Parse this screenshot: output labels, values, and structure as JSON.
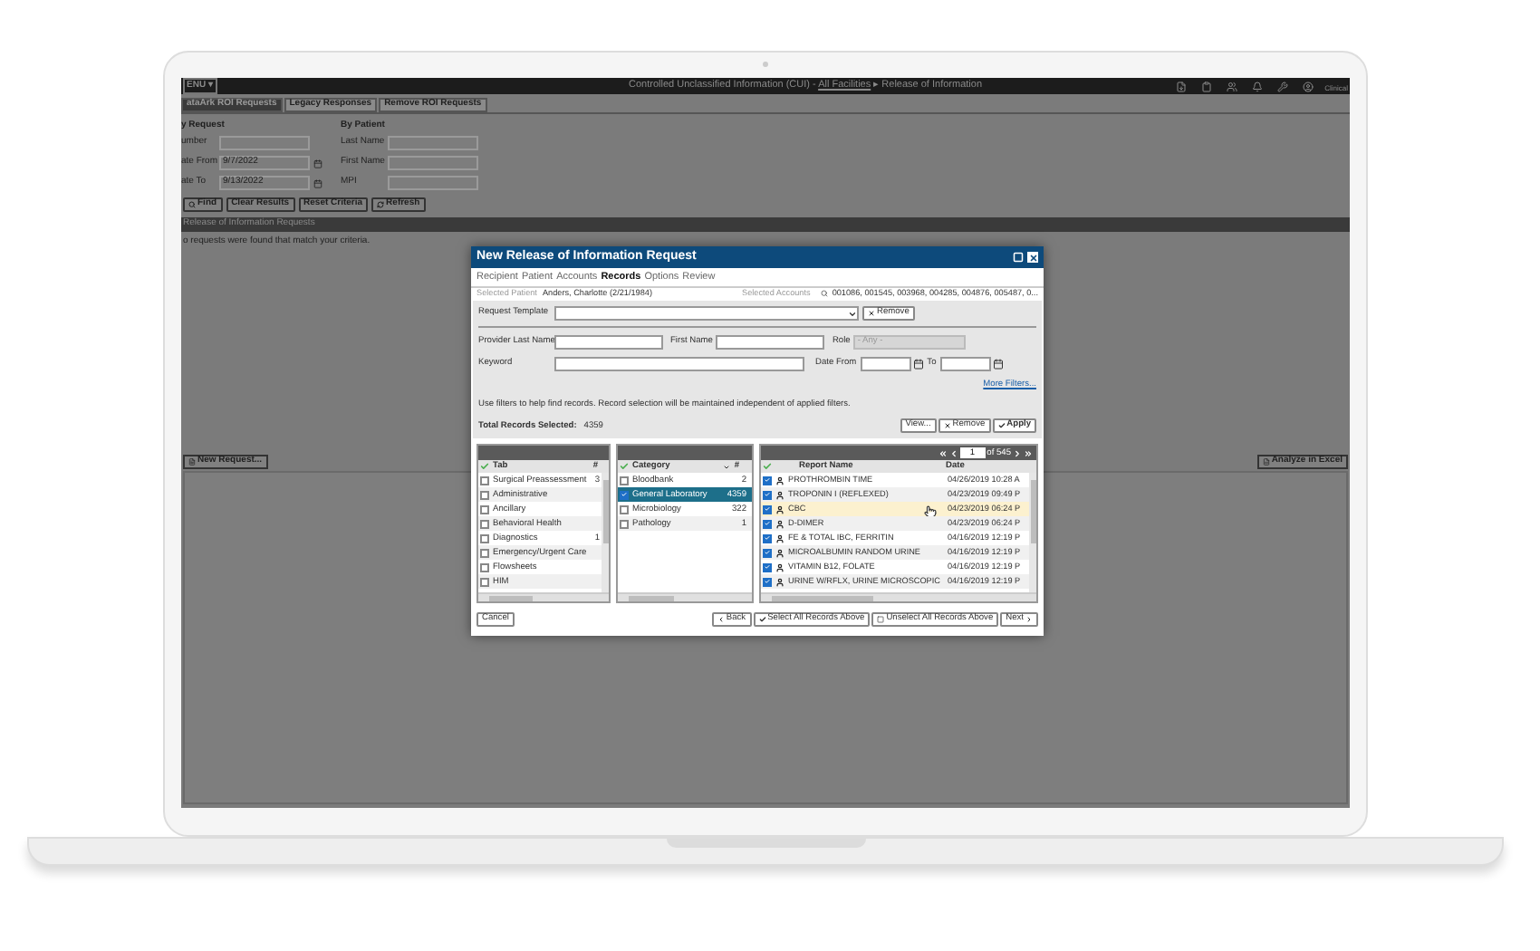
{
  "top_bar": {
    "menu": "ENU ▾",
    "title": "Controlled Unclassified Information (CUI) - ",
    "facility_link": "All Facilities",
    "location": " ▸ Release of Information",
    "user": "Clinical"
  },
  "tabs": [
    {
      "label": "ataArk ROI Requests",
      "selected": true
    },
    {
      "label": "Legacy Responses",
      "selected": false
    },
    {
      "label": "Remove ROI Requests",
      "selected": false
    }
  ],
  "by_request": {
    "heading": "y Request",
    "fields": [
      {
        "label": "umber",
        "kind": "text"
      },
      {
        "label": "ate From",
        "value": "9/7/2022",
        "kind": "date"
      },
      {
        "label": "ate To",
        "value": "9/13/2022",
        "kind": "date"
      }
    ]
  },
  "by_patient": {
    "heading": "By Patient",
    "fields": [
      {
        "label": "Last Name"
      },
      {
        "label": "First Name"
      },
      {
        "label": "MPI"
      }
    ]
  },
  "search_buttons": [
    {
      "label": "Find",
      "kind": "find"
    },
    {
      "label": "Clear Results",
      "kind": "plain"
    },
    {
      "label": "Reset Criteria",
      "kind": "plain"
    },
    {
      "label": "Refresh",
      "kind": "refresh"
    }
  ],
  "results": {
    "title": "Release of Information Requests",
    "message": "o requests were found that match your criteria."
  },
  "new_request_button": "New Request...",
  "excel_button": "Analyze in Excel",
  "dialog": {
    "title": "New Release of Information Request",
    "steps": [
      {
        "label": "Recipient",
        "selected": false
      },
      {
        "label": "Patient",
        "selected": false
      },
      {
        "label": "Accounts",
        "selected": false
      },
      {
        "label": "Records",
        "selected": true
      },
      {
        "label": "Options",
        "selected": false
      },
      {
        "label": "Review",
        "selected": false
      }
    ],
    "selected_patient_label": "Selected Patient",
    "selected_patient": "Anders, Charlotte (2/21/1984)",
    "selected_accounts_label": "Selected Accounts",
    "selected_accounts": "001086, 001545, 003968, 004285, 004876, 005487, 0...",
    "request_template_label": "Request Template",
    "template_remove": "Remove",
    "provider_last_name_label": "Provider Last Name",
    "first_name_label": "First Name",
    "role_label": "Role",
    "role_value": "- Any -",
    "keyword_label": "Keyword",
    "date_from_label": "Date From",
    "to_label": "To",
    "more_filters": "More Filters...",
    "hint": "Use filters to help find records. Record selection will be maintained independent of applied filters.",
    "total_label": "Total Records Selected:",
    "total": "4359",
    "filter_buttons": [
      {
        "label": "View...",
        "kind": "plain"
      },
      {
        "label": "Remove",
        "kind": "remove"
      },
      {
        "label": "Apply",
        "kind": "apply"
      }
    ],
    "tab_list": {
      "columns": [
        "Tab",
        "#"
      ],
      "items": [
        {
          "label": "Surgical Preassessment",
          "count": "3",
          "checked": false
        },
        {
          "label": "Administrative",
          "checked": false
        },
        {
          "label": "Ancillary",
          "checked": false
        },
        {
          "label": "Behavioral Health",
          "checked": false
        },
        {
          "label": "Diagnostics",
          "count": "1",
          "checked": false
        },
        {
          "label": "Emergency/Urgent Care",
          "checked": false
        },
        {
          "label": "Flowsheets",
          "checked": false
        },
        {
          "label": "HIM",
          "checked": false
        }
      ]
    },
    "category_list": {
      "columns": [
        "Category",
        "#"
      ],
      "items": [
        {
          "label": "Bloodbank",
          "count": "2",
          "checked": false,
          "selected": false
        },
        {
          "label": "General Laboratory",
          "count": "4359",
          "checked": true,
          "selected": true
        },
        {
          "label": "Microbiology",
          "count": "322",
          "checked": false,
          "selected": false
        },
        {
          "label": "Pathology",
          "count": "1",
          "checked": false,
          "selected": false
        }
      ]
    },
    "report_list": {
      "page": "1",
      "page_of": "of 545",
      "columns": [
        "Report Name",
        "Date"
      ],
      "rows": [
        {
          "name": "PROTHROMBIN TIME",
          "date": "04/26/2019 10:28 A",
          "checked": true,
          "highlighted": false
        },
        {
          "name": "TROPONIN I (REFLEXED)",
          "date": "04/23/2019 09:49 P",
          "checked": true,
          "highlighted": false
        },
        {
          "name": "CBC",
          "date": "04/23/2019 06:24 P",
          "checked": true,
          "highlighted": true
        },
        {
          "name": "D-DIMER",
          "date": "04/23/2019 06:24 P",
          "checked": true,
          "highlighted": false
        },
        {
          "name": "FE & TOTAL IBC, FERRITIN",
          "date": "04/16/2019 12:19 P",
          "checked": true,
          "highlighted": false
        },
        {
          "name": "MICROALBUMIN RANDOM URINE",
          "date": "04/16/2019 12:19 P",
          "checked": true,
          "highlighted": false
        },
        {
          "name": "VITAMIN B12, FOLATE",
          "date": "04/16/2019 12:19 P",
          "checked": true,
          "highlighted": false
        },
        {
          "name": "URINE W/RFLX, URINE MICROSCOPIC",
          "date": "04/16/2019 12:19 P",
          "checked": true,
          "highlighted": false
        }
      ]
    },
    "cancel_button": "Cancel",
    "footer_buttons": [
      {
        "label": "Back",
        "kind": "back"
      },
      {
        "label": "Select All Records Above",
        "kind": "select"
      },
      {
        "label": "Unselect All Records Above",
        "kind": "unselect"
      },
      {
        "label": "Next",
        "kind": "next"
      }
    ]
  }
}
